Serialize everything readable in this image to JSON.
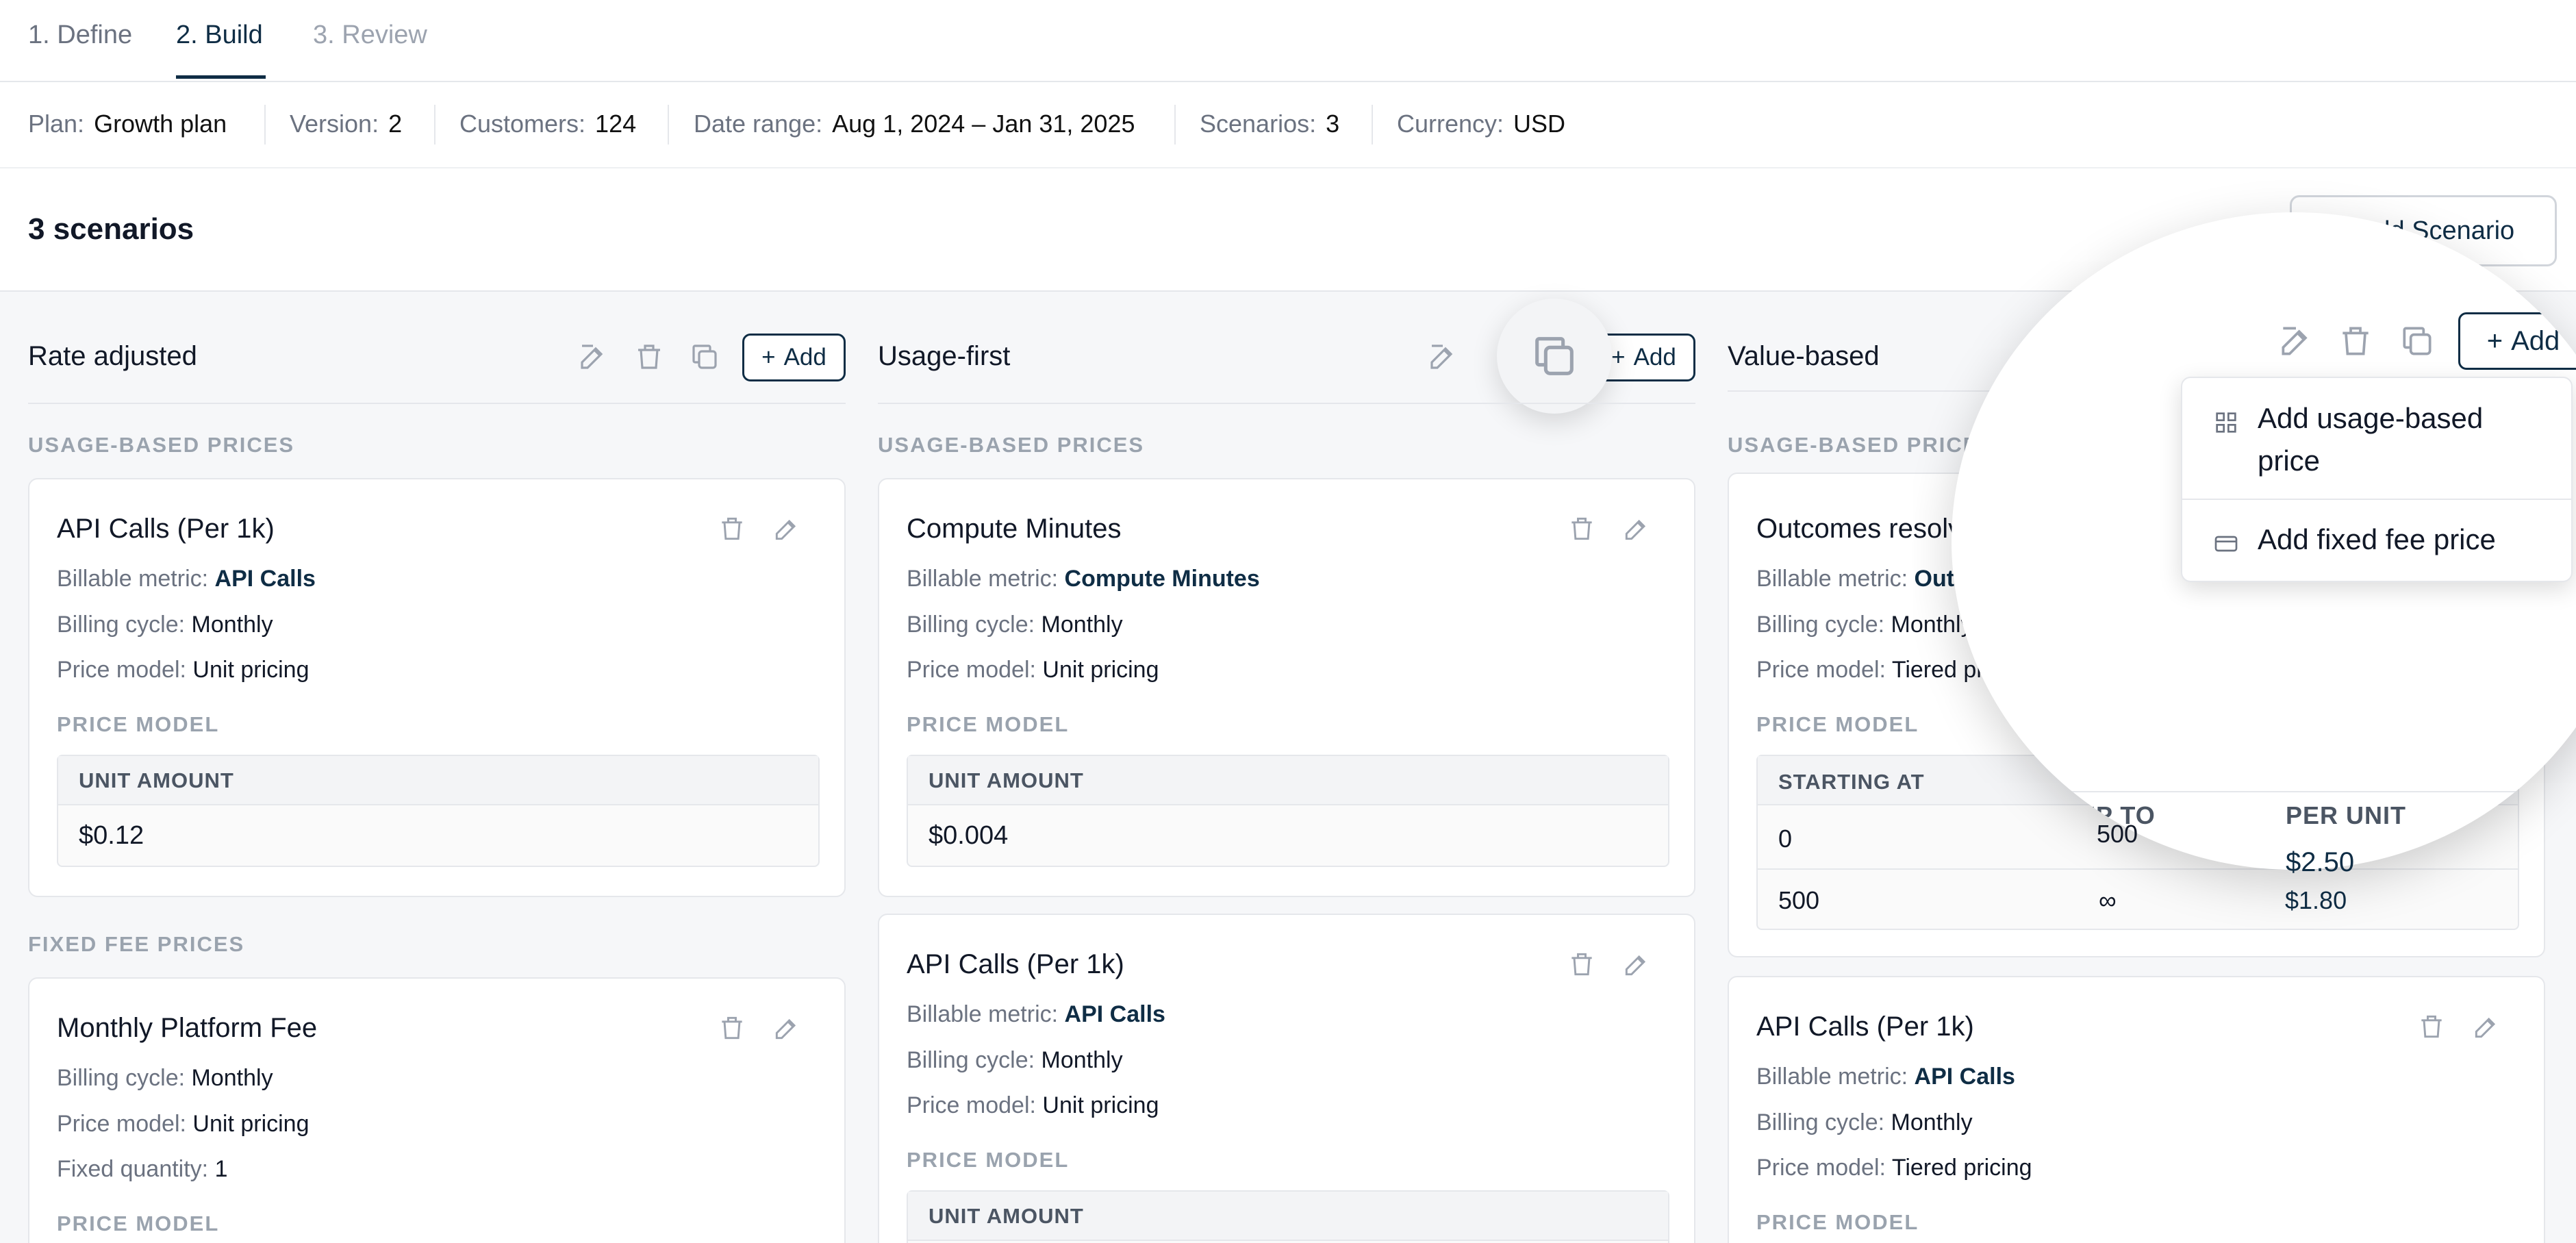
{
  "tabs": [
    {
      "label": "1. Define"
    },
    {
      "label": "2. Build"
    },
    {
      "label": "3. Review"
    }
  ],
  "info": {
    "plan_label": "Plan:",
    "plan_value": "Growth plan",
    "version_label": "Version:",
    "version_value": "2",
    "customers_label": "Customers:",
    "customers_value": "124",
    "date_label": "Date range:",
    "date_value": "Aug 1, 2024 – Jan 31, 2025",
    "scenarios_label": "Scenarios:",
    "scenarios_value": "3",
    "currency_label": "Currency:",
    "currency_value": "USD"
  },
  "header": {
    "title": "3 scenarios",
    "add_scenario_label": "Add Scenario"
  },
  "common": {
    "add_label": "Add",
    "usage_prices_label": "USAGE-BASED PRICES",
    "fixed_prices_label": "FIXED FEE PRICES",
    "price_model_label": "PRICE MODEL",
    "unit_amount_label": "UNIT AMOUNT",
    "billable_metric_label": "Billable metric:",
    "billing_cycle_label": "Billing cycle:",
    "price_model_row_label": "Price model:",
    "fixed_quantity_label": "Fixed quantity:"
  },
  "scenarios": [
    {
      "name": "Rate adjusted",
      "usage_card": {
        "title": "API Calls (Per 1k)",
        "metric": "API Calls",
        "cycle": "Monthly",
        "model": "Unit pricing",
        "amount": "$0.12"
      },
      "fixed_card": {
        "title": "Monthly Platform Fee",
        "cycle": "Monthly",
        "model": "Unit pricing",
        "quantity": "1"
      }
    },
    {
      "name": "Usage-first",
      "usage_card": {
        "title": "Compute Minutes",
        "metric": "Compute Minutes",
        "cycle": "Monthly",
        "model": "Unit pricing",
        "amount": "$0.004"
      },
      "usage_card_2": {
        "title": "API Calls (Per 1k)",
        "metric": "API Calls",
        "cycle": "Monthly",
        "model": "Unit pricing"
      }
    },
    {
      "name": "Value-based",
      "usage_card": {
        "title": "Outcomes resolved",
        "metric": "Outcomes resolved",
        "cycle": "Monthly",
        "model": "Tiered pricing",
        "tier_headers": [
          "STARTING AT",
          "UP TO",
          "PER UNIT"
        ],
        "tiers": [
          [
            "0",
            "500",
            "$2.50"
          ],
          [
            "500",
            "∞",
            "$1.80"
          ]
        ]
      },
      "usage_card_2": {
        "title": "API Calls (Per 1k)",
        "metric": "API Calls",
        "cycle": "Monthly",
        "model": "Tiered pricing"
      }
    }
  ],
  "dropdown": {
    "usage_item": "Add usage-based price",
    "fixed_item": "Add fixed fee price"
  }
}
